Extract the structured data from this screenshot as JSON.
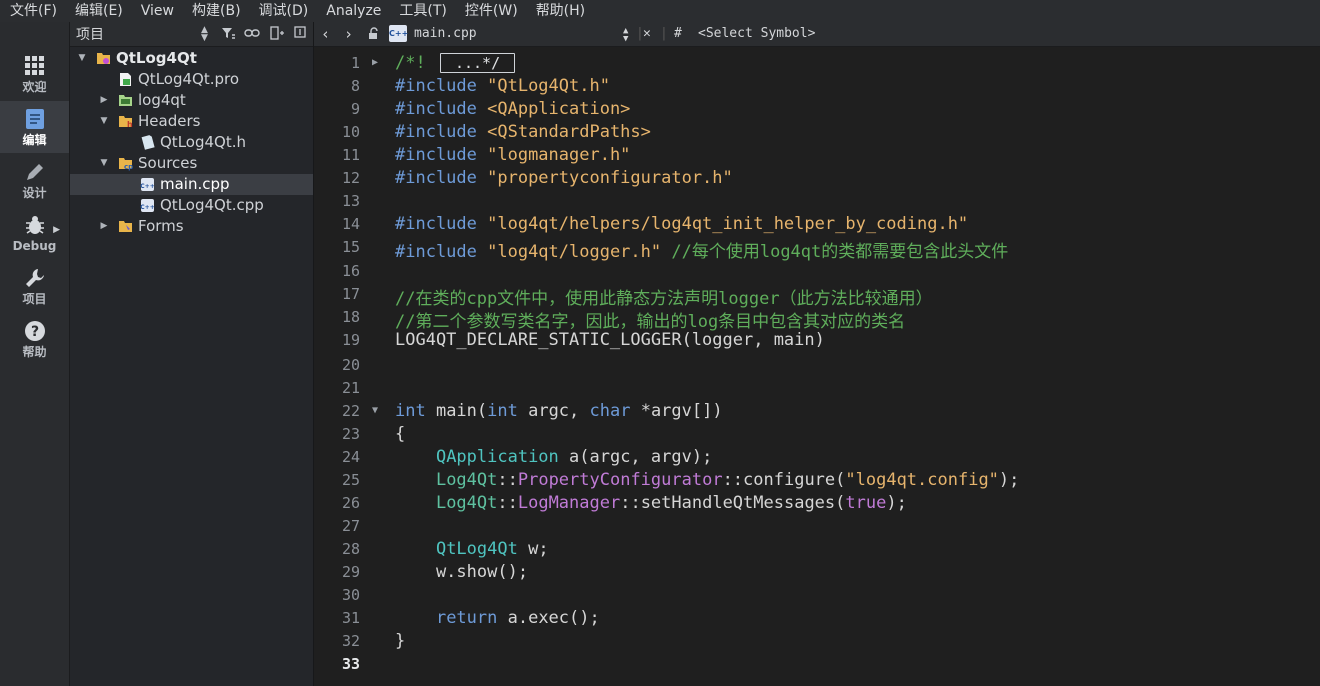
{
  "menu": [
    "文件(F)",
    "编辑(E)",
    "View",
    "构建(B)",
    "调试(D)",
    "Analyze",
    "工具(T)",
    "控件(W)",
    "帮助(H)"
  ],
  "modes": [
    {
      "label": "欢迎",
      "icon": "grid-icon"
    },
    {
      "label": "编辑",
      "icon": "document-icon",
      "active": true
    },
    {
      "label": "设计",
      "icon": "pencil-icon"
    },
    {
      "label": "Debug",
      "icon": "bug-icon"
    },
    {
      "label": "项目",
      "icon": "wrench-icon"
    },
    {
      "label": "帮助",
      "icon": "help-icon"
    }
  ],
  "project_pane": {
    "combo_label": "项目",
    "tree": [
      {
        "label": "QtLog4Qt",
        "depth": 0,
        "expanded": true,
        "icon": "project-icon",
        "bold": true
      },
      {
        "label": "QtLog4Qt.pro",
        "depth": 1,
        "expanded": null,
        "icon": "pro-file-icon"
      },
      {
        "label": "log4qt",
        "depth": 1,
        "expanded": false,
        "icon": "folder-icon"
      },
      {
        "label": "Headers",
        "depth": 1,
        "expanded": true,
        "icon": "headers-folder-icon"
      },
      {
        "label": "QtLog4Qt.h",
        "depth": 2,
        "expanded": null,
        "icon": "header-file-icon"
      },
      {
        "label": "Sources",
        "depth": 1,
        "expanded": true,
        "icon": "sources-folder-icon"
      },
      {
        "label": "main.cpp",
        "depth": 2,
        "expanded": null,
        "icon": "cpp-file-icon",
        "selected": true
      },
      {
        "label": "QtLog4Qt.cpp",
        "depth": 2,
        "expanded": null,
        "icon": "cpp-file-icon"
      },
      {
        "label": "Forms",
        "depth": 1,
        "expanded": false,
        "icon": "forms-folder-icon"
      }
    ]
  },
  "editor_toolbar": {
    "file_name": "main.cpp",
    "file_badge": "C++",
    "hash": "#",
    "symbol_placeholder": "<Select Symbol>"
  },
  "editor": {
    "current_line": "33",
    "lines": [
      {
        "n": "1",
        "fold": "collapsed",
        "tokens": [
          [
            "c-comment",
            "/*! "
          ],
          [
            "fold-box",
            "...*/"
          ]
        ]
      },
      {
        "n": "8",
        "tokens": [
          [
            "c-kw",
            "#include "
          ],
          [
            "c-str",
            "\"QtLog4Qt.h\""
          ]
        ]
      },
      {
        "n": "9",
        "tokens": [
          [
            "c-kw",
            "#include "
          ],
          [
            "c-str",
            "<QApplication>"
          ]
        ]
      },
      {
        "n": "10",
        "tokens": [
          [
            "c-kw",
            "#include "
          ],
          [
            "c-str",
            "<QStandardPaths>"
          ]
        ]
      },
      {
        "n": "11",
        "tokens": [
          [
            "c-kw",
            "#include "
          ],
          [
            "c-str",
            "\"logmanager.h\""
          ]
        ]
      },
      {
        "n": "12",
        "tokens": [
          [
            "c-kw",
            "#include "
          ],
          [
            "c-str",
            "\"propertyconfigurator.h\""
          ]
        ]
      },
      {
        "n": "13",
        "tokens": []
      },
      {
        "n": "14",
        "tokens": [
          [
            "c-kw",
            "#include "
          ],
          [
            "c-str",
            "\"log4qt/helpers/log4qt_init_helper_by_coding.h\""
          ]
        ]
      },
      {
        "n": "15",
        "tokens": [
          [
            "c-kw",
            "#include "
          ],
          [
            "c-str",
            "\"log4qt/logger.h\""
          ],
          [
            "c-def",
            " "
          ],
          [
            "c-comment",
            "//每个使用log4qt的类都需要包含此头文件"
          ]
        ]
      },
      {
        "n": "16",
        "tokens": []
      },
      {
        "n": "17",
        "tokens": [
          [
            "c-comment",
            "//在类的cpp文件中，使用此静态方法声明logger（此方法比较通用）"
          ]
        ]
      },
      {
        "n": "18",
        "tokens": [
          [
            "c-comment",
            "//第二个参数写类名字，因此，输出的log条目中包含其对应的类名"
          ]
        ]
      },
      {
        "n": "19",
        "tokens": [
          [
            "c-def",
            "LOG4QT_DECLARE_STATIC_LOGGER(logger, main)"
          ]
        ]
      },
      {
        "n": "20",
        "tokens": []
      },
      {
        "n": "21",
        "tokens": []
      },
      {
        "n": "22",
        "fold": "expanded",
        "tokens": [
          [
            "c-kw",
            "int"
          ],
          [
            "c-def",
            " main("
          ],
          [
            "c-kw",
            "int"
          ],
          [
            "c-def",
            " argc, "
          ],
          [
            "c-kw",
            "char"
          ],
          [
            "c-def",
            " *argv[])"
          ]
        ]
      },
      {
        "n": "23",
        "tokens": [
          [
            "c-def",
            "{"
          ]
        ]
      },
      {
        "n": "24",
        "tokens": [
          [
            "c-def",
            "    "
          ],
          [
            "c-class",
            "QApplication"
          ],
          [
            "c-def",
            " a(argc, argv);"
          ]
        ]
      },
      {
        "n": "25",
        "tokens": [
          [
            "c-def",
            "    "
          ],
          [
            "c-type",
            "Log4Qt"
          ],
          [
            "c-def",
            "::"
          ],
          [
            "c-ns",
            "PropertyConfigurator"
          ],
          [
            "c-def",
            "::configure("
          ],
          [
            "c-str",
            "\"log4qt.config\""
          ],
          [
            "c-def",
            ");"
          ]
        ]
      },
      {
        "n": "26",
        "tokens": [
          [
            "c-def",
            "    "
          ],
          [
            "c-type",
            "Log4Qt"
          ],
          [
            "c-def",
            "::"
          ],
          [
            "c-ns",
            "LogManager"
          ],
          [
            "c-def",
            "::setHandleQtMessages("
          ],
          [
            "c-ns",
            "true"
          ],
          [
            "c-def",
            ");"
          ]
        ]
      },
      {
        "n": "27",
        "tokens": []
      },
      {
        "n": "28",
        "tokens": [
          [
            "c-def",
            "    "
          ],
          [
            "c-class",
            "QtLog4Qt"
          ],
          [
            "c-def",
            " w;"
          ]
        ]
      },
      {
        "n": "29",
        "tokens": [
          [
            "c-def",
            "    w.show();"
          ]
        ]
      },
      {
        "n": "30",
        "tokens": []
      },
      {
        "n": "31",
        "tokens": [
          [
            "c-def",
            "    "
          ],
          [
            "c-kw",
            "return"
          ],
          [
            "c-def",
            " a.exec();"
          ]
        ]
      },
      {
        "n": "32",
        "tokens": [
          [
            "c-def",
            "}"
          ]
        ]
      },
      {
        "n": "33",
        "tokens": []
      }
    ]
  }
}
